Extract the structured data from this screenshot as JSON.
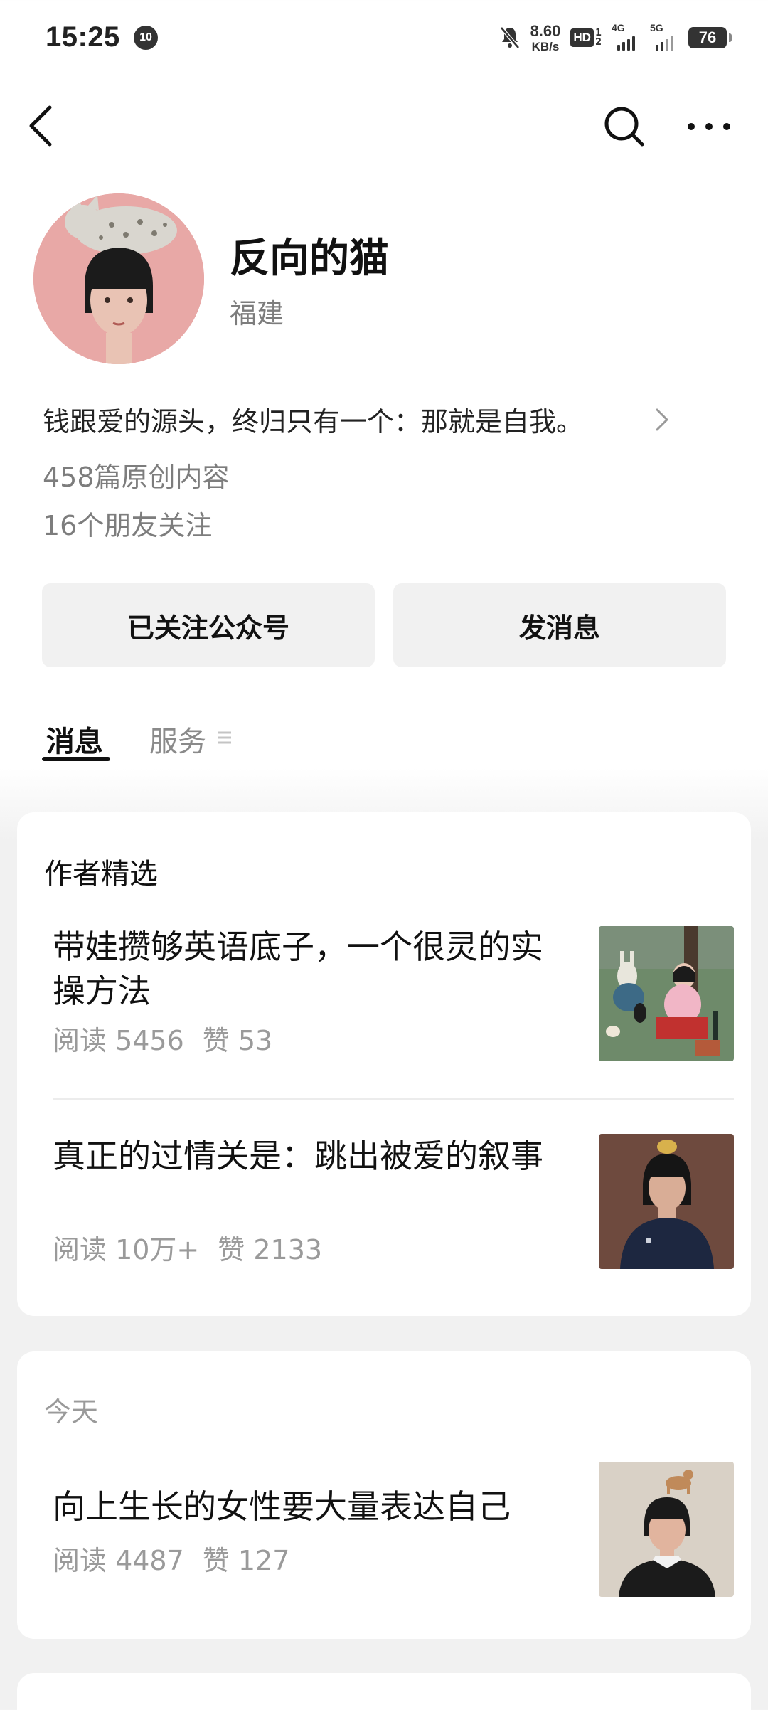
{
  "status_bar": {
    "time": "15:25",
    "notification_count": "10",
    "net_speed_value": "8.60",
    "net_speed_unit": "KB/s",
    "hd_label": "HD",
    "hd_sub1": "1",
    "hd_sub2": "2",
    "signal1_label": "4G",
    "signal2_label": "5G",
    "battery": "76"
  },
  "profile": {
    "name": "反向的猫",
    "location": "福建",
    "bio": "钱跟爱的源头，终归只有一个：那就是自我。",
    "original_count": "458篇原创内容",
    "friends_following": "16个朋友关注"
  },
  "actions": {
    "follow_label": "已关注公众号",
    "message_label": "发消息"
  },
  "tabs": {
    "messages": "消息",
    "services": "服务"
  },
  "featured": {
    "title": "作者精选",
    "articles": [
      {
        "title": "带娃攒够英语底子，一个很灵的实操方法",
        "reads": "阅读 5456",
        "likes": "赞 53"
      },
      {
        "title": "真正的过情关是：跳出被爱的叙事",
        "reads": "阅读 10万+",
        "likes": "赞 2133"
      }
    ]
  },
  "today": {
    "title": "今天",
    "articles": [
      {
        "title": "向上生长的女性要大量表达自己",
        "reads": "阅读 4487",
        "likes": "赞 127"
      }
    ]
  },
  "colors": {
    "accent_text": "#111111",
    "muted_text": "#9a9a9a",
    "button_bg": "#f1f1f1",
    "page_bg": "#f1f1f1"
  }
}
